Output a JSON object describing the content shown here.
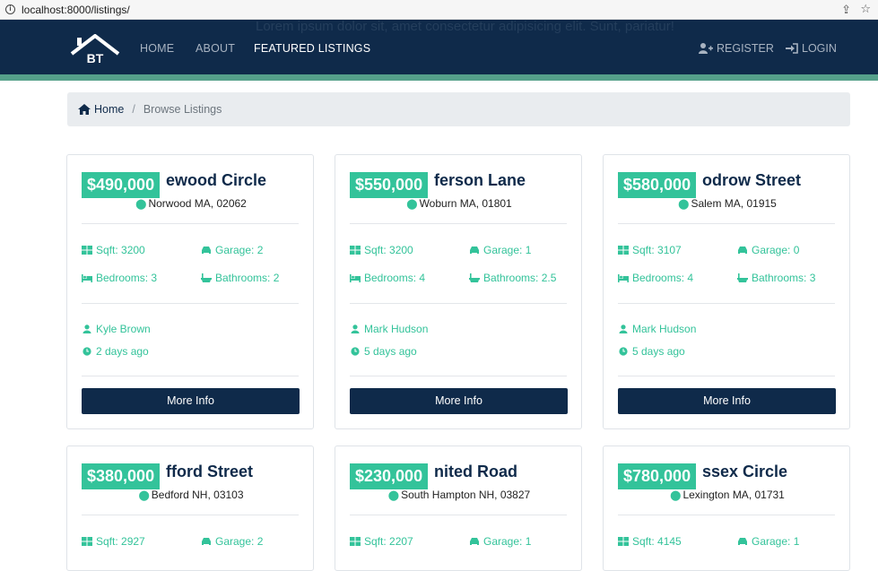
{
  "browser": {
    "url": "localhost:8000/listings/"
  },
  "nav": {
    "ghost_text": "Lorem ipsum dolor sit, amet consectetur adipisicing elit. Sunt, pariatur!",
    "logo_text": "BT",
    "home": "HOME",
    "about": "ABOUT",
    "featured": "FEATURED LISTINGS",
    "register": "REGISTER",
    "login": "LOGIN"
  },
  "breadcrumb": {
    "home": "Home",
    "sep": "/",
    "current": "Browse Listings"
  },
  "listings": [
    {
      "price": "$490,000",
      "street": "ewood Circle",
      "location": "Norwood MA, 02062",
      "sqft": "Sqft: 3200",
      "garage": "Garage: 2",
      "bedrooms": "Bedrooms: 3",
      "bathrooms": "Bathrooms: 2",
      "realtor": "Kyle Brown",
      "listed": "2 days ago",
      "button": "More Info"
    },
    {
      "price": "$550,000",
      "street": "ferson Lane",
      "location": "Woburn MA, 01801",
      "sqft": "Sqft: 3200",
      "garage": "Garage: 1",
      "bedrooms": "Bedrooms: 4",
      "bathrooms": "Bathrooms: 2.5",
      "realtor": "Mark Hudson",
      "listed": "5 days ago",
      "button": "More Info"
    },
    {
      "price": "$580,000",
      "street": "odrow Street",
      "location": "Salem MA, 01915",
      "sqft": "Sqft: 3107",
      "garage": "Garage: 0",
      "bedrooms": "Bedrooms: 4",
      "bathrooms": "Bathrooms: 3",
      "realtor": "Mark Hudson",
      "listed": "5 days ago",
      "button": "More Info"
    },
    {
      "price": "$380,000",
      "street": "fford Street",
      "location": "Bedford NH, 03103",
      "sqft": "Sqft: 2927",
      "garage": "Garage: 2"
    },
    {
      "price": "$230,000",
      "street": "nited Road",
      "location": "South Hampton NH, 03827",
      "sqft": "Sqft: 2207",
      "garage": "Garage: 1"
    },
    {
      "price": "$780,000",
      "street": "ssex Circle",
      "location": "Lexington MA, 01731",
      "sqft": "Sqft: 4145",
      "garage": "Garage: 1"
    }
  ],
  "colors": {
    "navy": "#0f2a4a",
    "accent": "#33c39a",
    "strip": "#55a08a"
  }
}
